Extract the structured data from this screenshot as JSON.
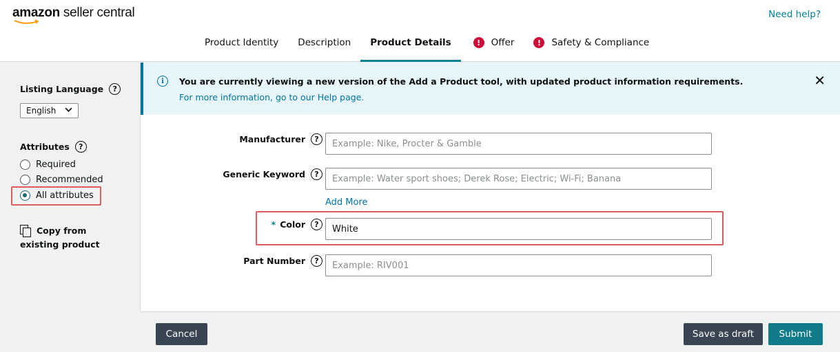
{
  "header": {
    "logo_text_bold": "amazon",
    "logo_text_rest": " seller central",
    "help_label": "Need help?",
    "tabs": [
      {
        "label": "Product Identity",
        "active": false,
        "error": false
      },
      {
        "label": "Description",
        "active": false,
        "error": false
      },
      {
        "label": "Product Details",
        "active": true,
        "error": true
      },
      {
        "label": "Offer",
        "active": false,
        "error": true
      },
      {
        "label": "Safety & Compliance",
        "active": false,
        "error": true
      }
    ],
    "error_glyph": "!"
  },
  "sidebar": {
    "listing_language_label": "Listing Language",
    "language_value": "English",
    "attributes_label": "Attributes",
    "radio_options": [
      "Required",
      "Recommended",
      "All attributes"
    ],
    "selected_option": "All attributes",
    "copy_line1": "Copy from",
    "copy_line2": "existing product",
    "help_glyph": "?"
  },
  "banner": {
    "message": "You are currently viewing a new version of the Add a Product tool, with updated product information requirements.",
    "link": "For more information, go to our Help page.",
    "close_glyph": "✕",
    "info_glyph": "i"
  },
  "form": {
    "manufacturer": {
      "label": "Manufacturer",
      "placeholder": "Example: Nike, Procter & Gamble",
      "value": ""
    },
    "generic_keyword": {
      "label": "Generic Keyword",
      "placeholder": "Example: Water sport shoes; Derek Rose; Electric; Wi-Fi; Banana",
      "value": ""
    },
    "add_more": "Add More",
    "color": {
      "label": "Color",
      "required_mark": "*",
      "placeholder": "",
      "value": "White"
    },
    "part_number": {
      "label": "Part Number",
      "placeholder": "Example: RIV001",
      "value": ""
    }
  },
  "footer": {
    "cancel_label": "Cancel",
    "save_draft_label": "Save as draft",
    "submit_label": "Submit"
  },
  "colors": {
    "accent_teal": "#008296",
    "error_red": "#cc0c39",
    "highlight_box": "#e05b5b",
    "banner_bg": "#e6f6fa"
  }
}
